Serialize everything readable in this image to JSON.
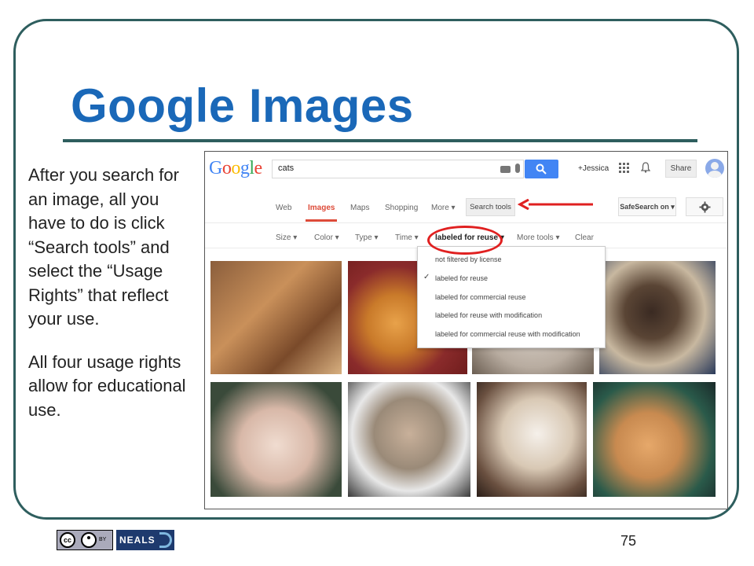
{
  "slide": {
    "title": "Google Images",
    "paragraphs": [
      "After you search for an image, all you have to do is click “Search tools” and select the “Usage Rights” that reflect your use.",
      "All four usage rights allow for educational use."
    ],
    "page_number": "75",
    "license_badge": "cc BY",
    "logo_text": "NEALS"
  },
  "google": {
    "logo": "Google",
    "query": "cats",
    "user": "+Jessica",
    "share_label": "Share",
    "tabs": [
      "Web",
      "Images",
      "Maps",
      "Shopping",
      "More ▾"
    ],
    "search_tools_label": "Search tools",
    "safesearch_label": "SafeSearch on ▾",
    "tools": [
      "Size ▾",
      "Color ▾",
      "Type ▾",
      "Time ▾",
      "labeled for reuse ▾",
      "More tools ▾",
      "Clear"
    ],
    "usage_menu": {
      "items": [
        "not filtered by license",
        "labeled for reuse",
        "labeled for commercial reuse",
        "labeled for reuse with modification",
        "labeled for commercial reuse with modification"
      ],
      "selected_index": 1
    },
    "accent_color": "#dd4b39",
    "button_color": "#4285f4"
  }
}
